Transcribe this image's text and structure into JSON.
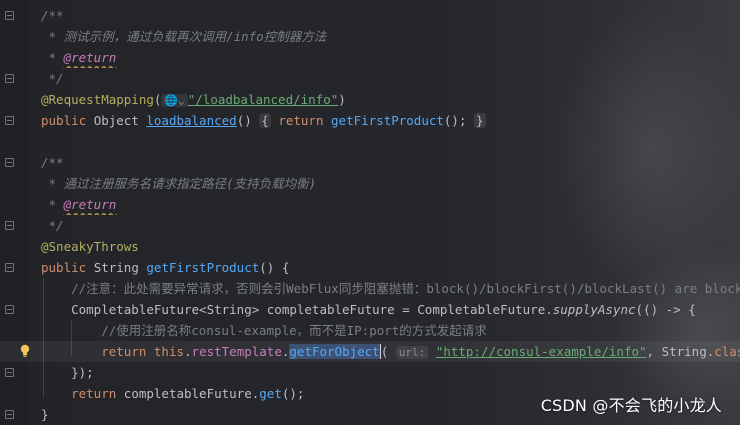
{
  "watermark": "CSDN @不会飞的小龙人",
  "lines": [
    {
      "fold": true,
      "segments": [
        {
          "cls": "cm",
          "t": "/**"
        }
      ]
    },
    {
      "segments": [
        {
          "cls": "cm",
          "t": " * 测试示例，通过负载再次调用/info控制器方法"
        }
      ]
    },
    {
      "segments": [
        {
          "cls": "cm",
          "t": " * "
        },
        {
          "cls": "tag",
          "t": "@return"
        }
      ]
    },
    {
      "fold": true,
      "segments": [
        {
          "cls": "cm",
          "t": " */"
        }
      ]
    },
    {
      "segments": [
        {
          "cls": "ann",
          "t": "@RequestMapping"
        },
        {
          "cls": "",
          "t": "("
        },
        {
          "cls": "inlay",
          "t": "🌐⌄"
        },
        {
          "cls": "link",
          "t": "\"/loadbalanced/info\""
        },
        {
          "cls": "",
          "t": ")"
        }
      ]
    },
    {
      "fold": true,
      "segments": [
        {
          "cls": "kw",
          "t": "public "
        },
        {
          "cls": "",
          "t": "Object "
        },
        {
          "cls": "fnu",
          "t": "loadbalanced"
        },
        {
          "cls": "",
          "t": "() "
        },
        {
          "cls": "fold-inline",
          "t": "{"
        },
        {
          "cls": "",
          "t": " "
        },
        {
          "cls": "kw",
          "t": "return "
        },
        {
          "cls": "fn",
          "t": "getFirstProduct"
        },
        {
          "cls": "",
          "t": "(); "
        },
        {
          "cls": "fold-inline",
          "t": "}"
        }
      ]
    },
    {
      "segments": []
    },
    {
      "fold": true,
      "segments": [
        {
          "cls": "cm",
          "t": "/**"
        }
      ]
    },
    {
      "segments": [
        {
          "cls": "cm",
          "t": " * 通过注册服务名请求指定路径(支持负载均衡)"
        }
      ]
    },
    {
      "segments": [
        {
          "cls": "cm",
          "t": " * "
        },
        {
          "cls": "tag",
          "t": "@return"
        }
      ]
    },
    {
      "fold": true,
      "segments": [
        {
          "cls": "cm",
          "t": " */"
        }
      ]
    },
    {
      "segments": [
        {
          "cls": "ann",
          "t": "@SneakyThrows"
        }
      ]
    },
    {
      "fold": true,
      "segments": [
        {
          "cls": "kw",
          "t": "public "
        },
        {
          "cls": "",
          "t": "String "
        },
        {
          "cls": "fn",
          "t": "getFirstProduct"
        },
        {
          "cls": "",
          "t": "() {"
        }
      ]
    },
    {
      "segments": [
        {
          "cls": "cmn",
          "t": "    //注意：此处需要异常请求，否则会引WebFlux同步阻塞抛错：block()/blockFirst()/blockLast() are blocking, w"
        }
      ]
    },
    {
      "fold": true,
      "segments": [
        {
          "cls": "",
          "t": "    CompletableFuture<String> completableFuture = CompletableFuture."
        },
        {
          "cls": "st",
          "t": "supplyAsync"
        },
        {
          "cls": "",
          "t": "(() -> {"
        }
      ]
    },
    {
      "segments": [
        {
          "cls": "cmn",
          "t": "        //使用注册名称consul-example，而不是IP:port的方式发起请求"
        }
      ]
    },
    {
      "current": true,
      "bulb": true,
      "segments": [
        {
          "cls": "",
          "t": "        "
        },
        {
          "cls": "kw",
          "t": "return this"
        },
        {
          "cls": "",
          "t": "."
        },
        {
          "cls": "fld",
          "t": "restTemplate"
        },
        {
          "cls": "",
          "t": "."
        },
        {
          "cls": "fn sel",
          "t": "getForObject"
        },
        {
          "cls": "cursor",
          "t": "("
        },
        {
          "cls": "",
          "t": " "
        },
        {
          "cls": "hint",
          "t": "url:"
        },
        {
          "cls": "",
          "t": " "
        },
        {
          "cls": "link",
          "t": "\"http://consul-example/info\""
        },
        {
          "cls": "",
          "t": ", String."
        },
        {
          "cls": "kw",
          "t": "class"
        },
        {
          "cls": "",
          "t": ");"
        }
      ]
    },
    {
      "fold": true,
      "segments": [
        {
          "cls": "",
          "t": "    });"
        }
      ]
    },
    {
      "segments": [
        {
          "cls": "",
          "t": "    "
        },
        {
          "cls": "kw",
          "t": "return "
        },
        {
          "cls": "",
          "t": "completableFuture."
        },
        {
          "cls": "fn",
          "t": "get"
        },
        {
          "cls": "",
          "t": "();"
        }
      ]
    },
    {
      "fold": true,
      "segments": [
        {
          "cls": "",
          "t": "}"
        }
      ]
    }
  ]
}
